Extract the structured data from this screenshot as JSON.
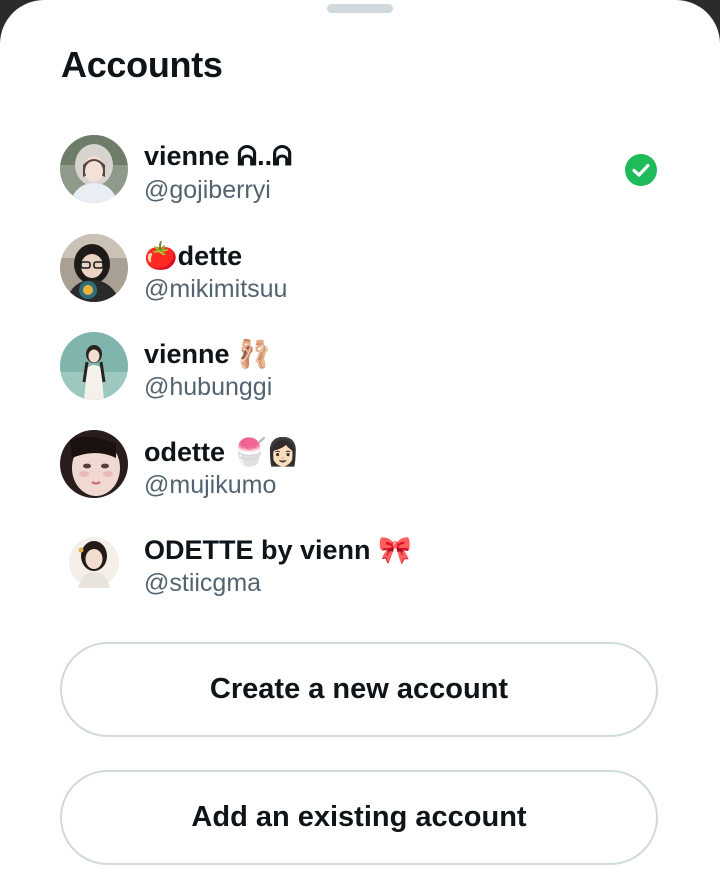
{
  "sheet": {
    "title": "Accounts"
  },
  "accounts": [
    {
      "name": "vienne ᕱ..ᕱ",
      "handle": "@gojiberryi",
      "selected": true,
      "avatar": "woman-with-hood"
    },
    {
      "name": "🍅dette",
      "handle": "@mikimitsuu",
      "selected": false,
      "avatar": "woman-with-glasses"
    },
    {
      "name": "vienne 🩰",
      "handle": "@hubunggi",
      "selected": false,
      "avatar": "woman-in-white-dress"
    },
    {
      "name": "odette 🍧👩🏻",
      "handle": "@mujikumo",
      "selected": false,
      "avatar": "close-up-face"
    },
    {
      "name": "ODETTE by vienn 🎀",
      "handle": "@stiicgma",
      "selected": false,
      "avatar": "woman-portrait"
    }
  ],
  "actions": {
    "create_label": "Create a new account",
    "add_label": "Add an existing account"
  },
  "colors": {
    "check_green": "#1fba5a",
    "text_primary": "#0f1419",
    "text_secondary": "#536471",
    "border": "#cfd9de"
  }
}
